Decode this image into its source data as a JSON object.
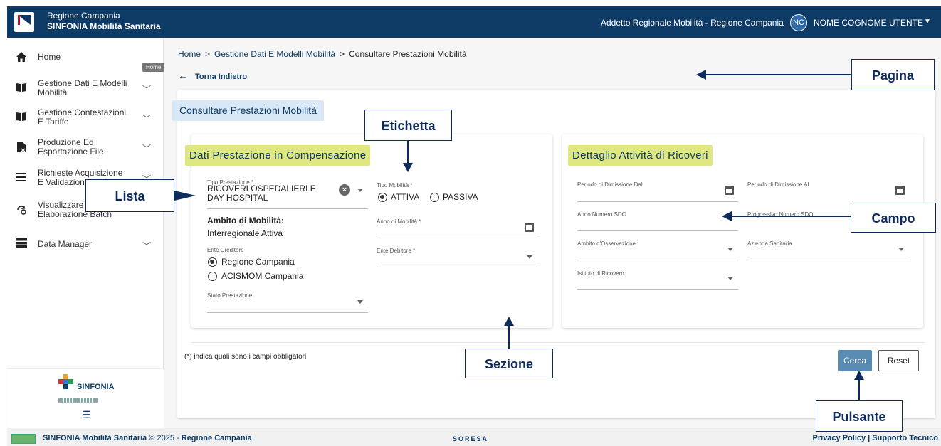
{
  "header": {
    "org": "Regione Campania",
    "app": "SINFONIA Mobilità Sanitaria",
    "role": "Addetto Regionale Mobilità - Regione Campania",
    "user_initials": "NC",
    "user_name": "NOME COGNOME UTENTE"
  },
  "sidebar": {
    "items": [
      {
        "label": "Home",
        "icon": "home-icon"
      },
      {
        "label": "Gestione Dati E Modelli Mobilità",
        "icon": "book-icon"
      },
      {
        "label": "Gestione Contestazioni E Tariffe",
        "icon": "book-icon"
      },
      {
        "label": "Produzione Ed Esportazione File",
        "icon": "file-export-icon"
      },
      {
        "label": "Richieste Acquisizione E Validazione Dati",
        "icon": "list-icon"
      },
      {
        "label": "Visualizzare Report Elaborazione Batch",
        "icon": "sync-settings-icon"
      },
      {
        "label": "Data Manager",
        "icon": "database-icon"
      }
    ],
    "tooltip": "Home",
    "brand": "SINFONIA"
  },
  "breadcrumb": {
    "home": "Home",
    "sep": ">",
    "level1": "Gestione Dati E Modelli Mobilità",
    "current": "Consultare Prestazioni Mobilità"
  },
  "back_label": "Torna Indietro",
  "page_title": "Consultare Prestazioni Mobilità",
  "section1": {
    "title": "Dati Prestazione in Compensazione",
    "tipo_prestazione": {
      "label": "Tipo Prestazione *",
      "value": "RICOVERI OSPEDALIERI E DAY HOSPITAL"
    },
    "ambito": {
      "label": "Ambito di Mobilità:",
      "value": "Interregionale Attiva"
    },
    "ente_creditore": {
      "label": "Ente Creditore",
      "options": [
        "Regione Campania",
        "ACISMOM Campania"
      ],
      "selected": "Regione Campania"
    },
    "stato": {
      "label": "Stato Prestazione"
    },
    "tipo_mobilita": {
      "label": "Tipo Mobilità *",
      "options": [
        "ATTIVA",
        "PASSIVA"
      ],
      "selected": "ATTIVA"
    },
    "anno": {
      "label": "Anno di Mobilità *"
    },
    "ente_debitore": {
      "label": "Ente Debitore *"
    }
  },
  "section2": {
    "title": "Dettaglio Attività di Ricoveri",
    "dim_dal": "Periodo di Dimissione Dal",
    "dim_al": "Periodo di Dimissione Al",
    "anno_sdo": "Anno Numero SDO",
    "prog_sdo": "Progressivo Numero SDO",
    "ambito_oss": "Ambito d'Osservazione",
    "azienda": "Azienda Sanitaria",
    "istituto": "Istituto di Ricovero"
  },
  "note": "(*) indica quali sono i campi obbligatori",
  "buttons": {
    "search": "Cerca",
    "reset": "Reset"
  },
  "footer": {
    "app": "SINFONIA Mobilità Sanitaria",
    "copy": " © 2025 - ",
    "org": "Regione Campania",
    "center": "SORESA",
    "links": "Privacy Policy | Supporto Tecnico"
  },
  "annotations": {
    "pagina": "Pagina",
    "etichetta": "Etichetta",
    "lista": "Lista",
    "campo": "Campo",
    "sezione": "Sezione",
    "pulsante": "Pulsante"
  },
  "colors": {
    "primary": "#0d3b66",
    "title_bg": "#d9e8f7",
    "section_title_bg": "#dfe880",
    "button": "#5a8cb3"
  }
}
